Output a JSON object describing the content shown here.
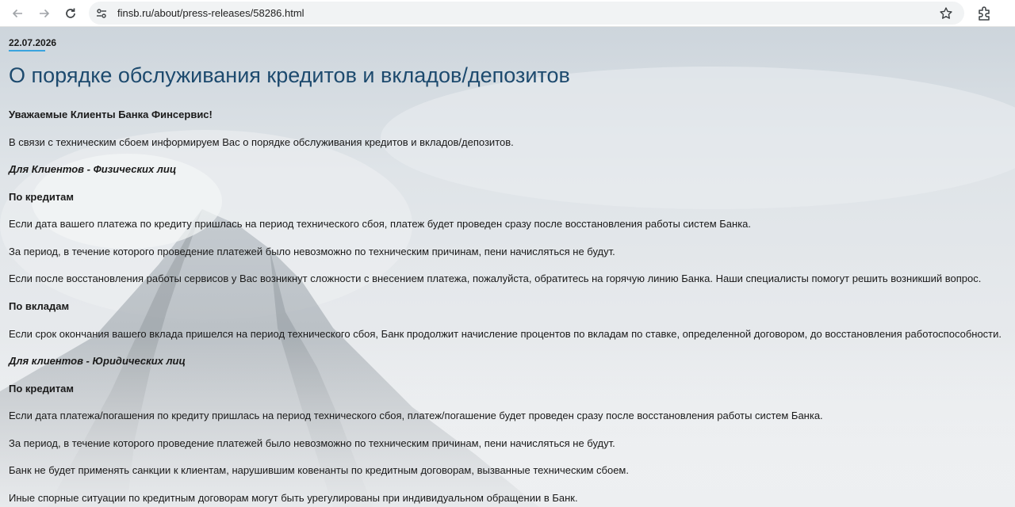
{
  "browser": {
    "url": "finsb.ru/about/press-releases/58286.html",
    "icons": [
      "back-arrow-icon",
      "forward-arrow-icon",
      "reload-icon",
      "site-info-icon",
      "star-icon",
      "extensions-icon"
    ]
  },
  "article": {
    "date": "22.07.2026",
    "title": "О порядке обслуживания кредитов и вкладов/депозитов",
    "greeting": "Уважаемые Клиенты Банка Финсервис!",
    "intro": "В связи с техническим сбоем информируем Вас о порядке обслуживания кредитов и вкладов/депозитов.",
    "individuals": {
      "heading": "Для Клиентов - Физических лиц",
      "credits_heading": "По кредитам",
      "credits_p1": "Если дата вашего платежа по кредиту пришлась на период технического сбоя, платеж будет проведен сразу после восстановления работы систем Банка.",
      "credits_p2": "За период, в течение которого проведение платежей было невозможно по техническим причинам, пени начисляться не будут.",
      "credits_p3": "Если после восстановления работы сервисов у Вас возникнут сложности с внесением платежа, пожалуйста, обратитесь на горячую линию Банка. Наши специалисты помогут решить возникший вопрос.",
      "deposits_heading": "По вкладам",
      "deposits_p1": "Если срок окончания вашего вклада пришелся на период технического сбоя, Банк продолжит начисление процентов по вкладам по ставке, определенной договором, до восстановления работоспособности."
    },
    "legal": {
      "heading": "Для клиентов - Юридических лиц",
      "credits_heading": "По кредитам",
      "credits_p1": "Если дата платежа/погашения по кредиту пришлась на период технического сбоя, платеж/погашение будет проведен сразу после восстановления работы систем Банка.",
      "credits_p2": "За период, в течение которого проведение платежей было невозможно по техническим причинам, пени начисляться не будут.",
      "credits_p3": "Банк не будет применять санкции к клиентам, нарушившим ковенанты по кредитным договорам, вызванные техническим сбоем.",
      "credits_p4": "Иные спорные ситуации по кредитным договорам могут быть урегулированы при индивидуальном обращении в Банк."
    }
  },
  "colors": {
    "title": "#1d4a6e",
    "date_underline": "#3aa4de",
    "text": "#1a1a1a"
  }
}
